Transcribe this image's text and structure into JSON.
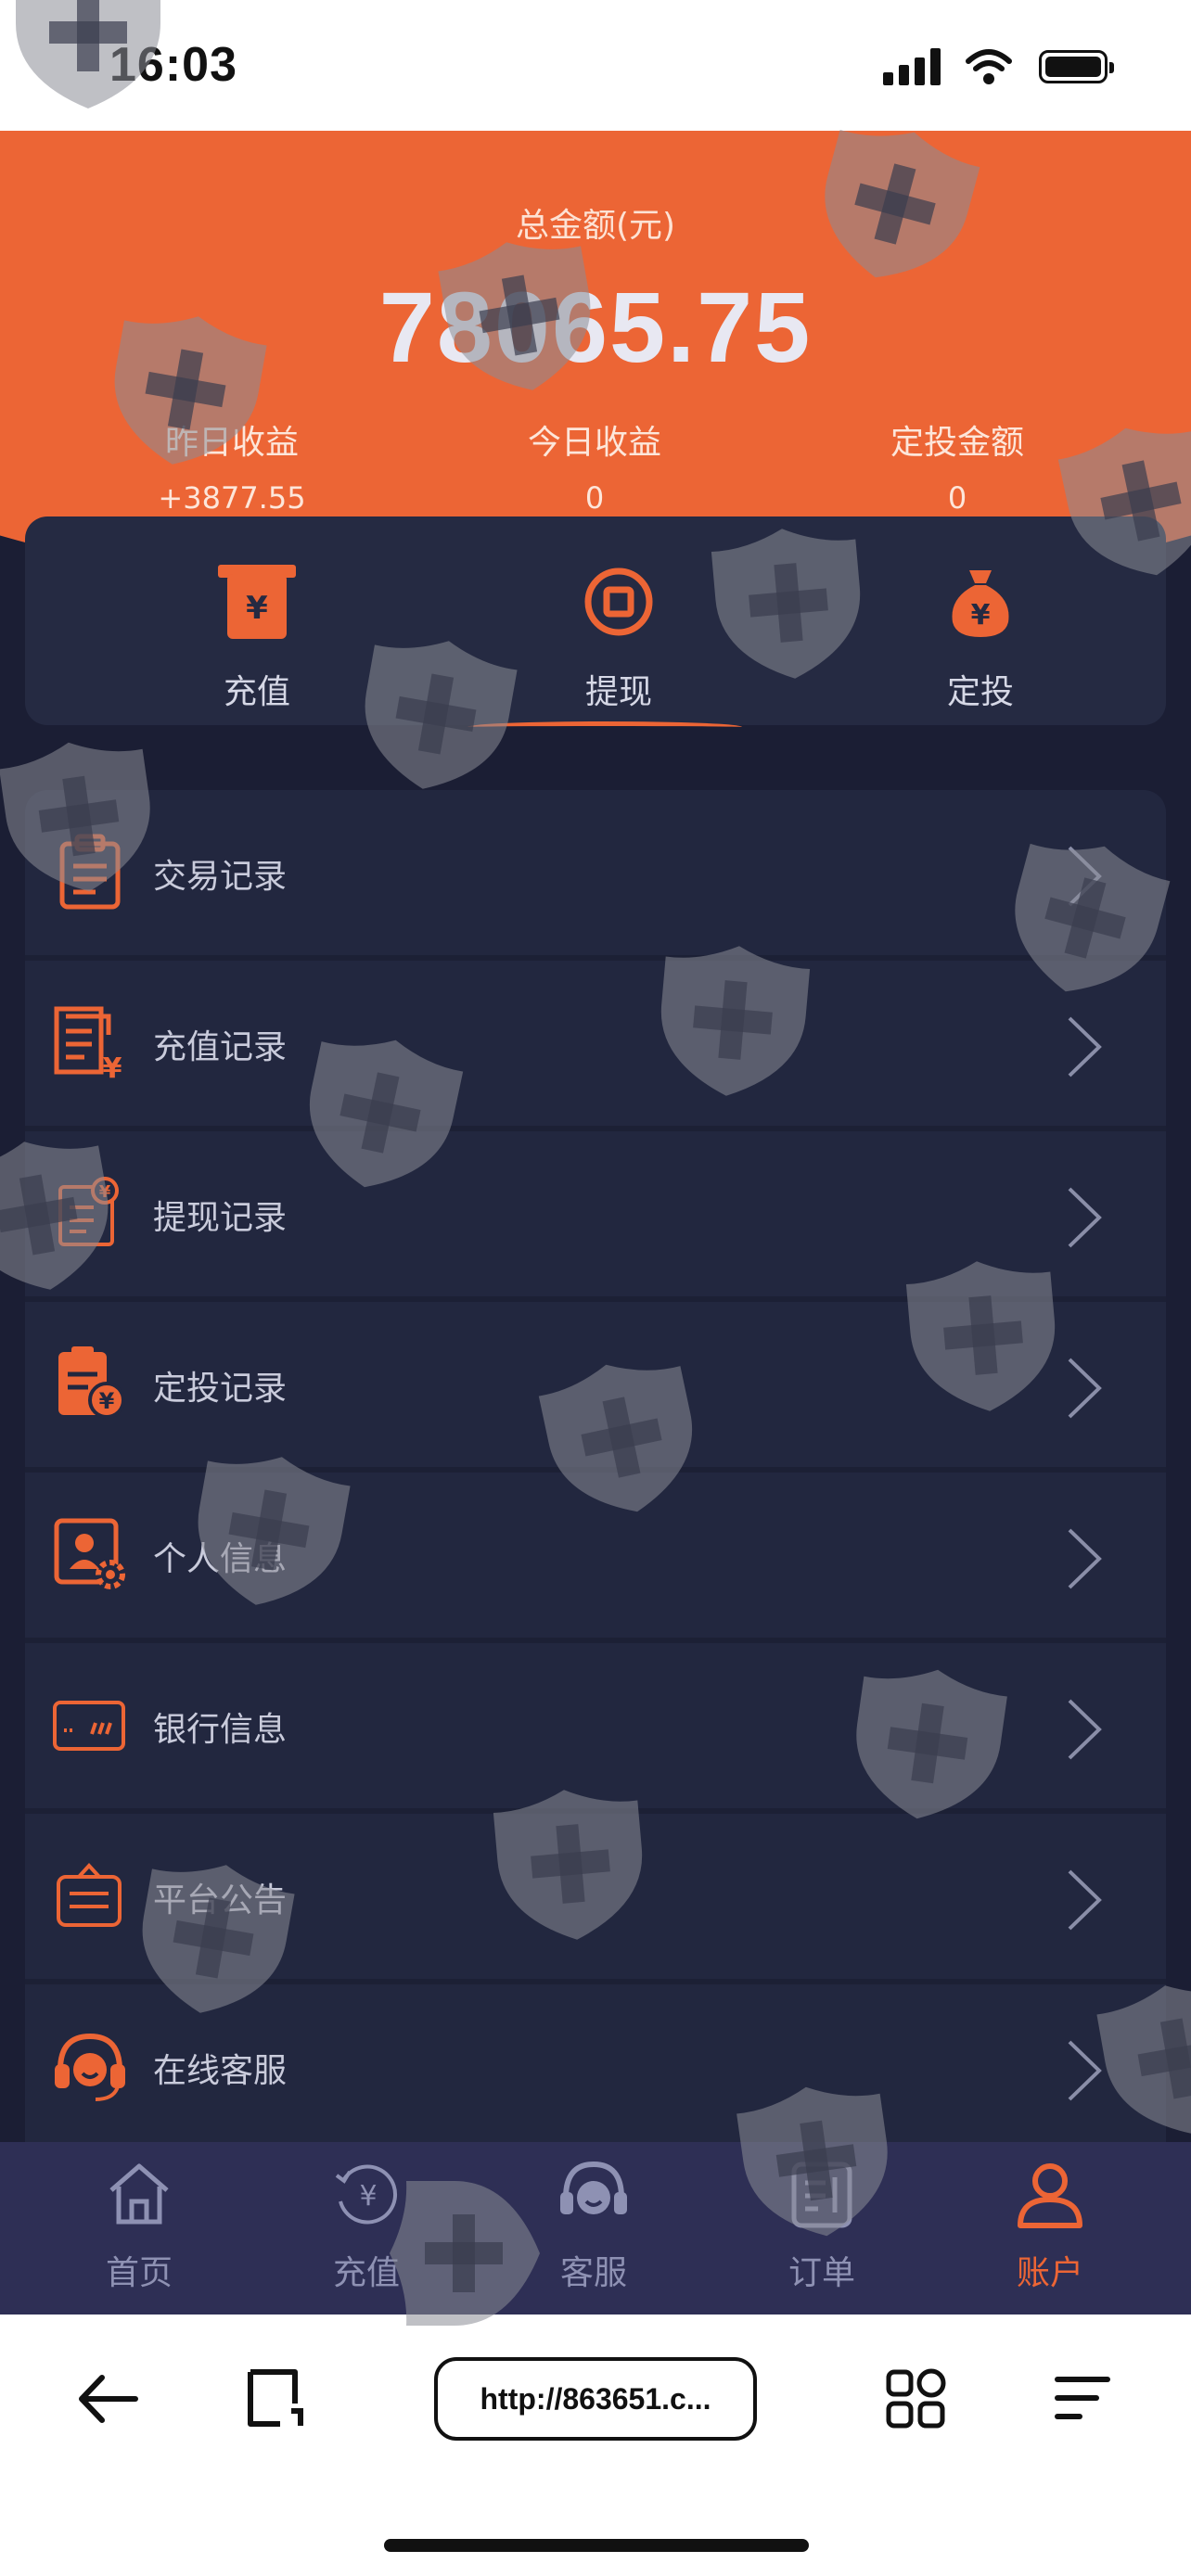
{
  "status_bar": {
    "time": "16:03"
  },
  "header": {
    "total_label": "总金额(元)",
    "total_amount": "78065.75",
    "stats": [
      {
        "label": "昨日收益",
        "value": "+3877.55"
      },
      {
        "label": "今日收益",
        "value": "0"
      },
      {
        "label": "定投金额",
        "value": "0"
      }
    ]
  },
  "actions": [
    {
      "label": "充值",
      "icon": "atm-yuan-icon"
    },
    {
      "label": "提现",
      "icon": "withdraw-circle-icon"
    },
    {
      "label": "定投",
      "icon": "money-bag-icon"
    }
  ],
  "menu": [
    {
      "label": "交易记录",
      "icon": "clipboard-icon"
    },
    {
      "label": "充值记录",
      "icon": "document-yuan-icon"
    },
    {
      "label": "提现记录",
      "icon": "withdraw-record-icon"
    },
    {
      "label": "定投记录",
      "icon": "invest-record-icon"
    },
    {
      "label": "个人信息",
      "icon": "profile-settings-icon"
    },
    {
      "label": "银行信息",
      "icon": "bank-card-icon"
    },
    {
      "label": "平台公告",
      "icon": "announcement-icon"
    },
    {
      "label": "在线客服",
      "icon": "headset-icon"
    }
  ],
  "tabs": [
    {
      "label": "首页",
      "icon": "home-icon",
      "active": false
    },
    {
      "label": "充值",
      "icon": "recharge-icon",
      "active": false
    },
    {
      "label": "客服",
      "icon": "support-icon",
      "active": false
    },
    {
      "label": "订单",
      "icon": "order-icon",
      "active": false
    },
    {
      "label": "账户",
      "icon": "user-icon",
      "active": true
    }
  ],
  "browser": {
    "url": "http://863651.c..."
  },
  "colors": {
    "accent": "#ec6535",
    "background": "#1b1e34",
    "card": "#252a42",
    "tab_bar": "#2e2f55"
  }
}
